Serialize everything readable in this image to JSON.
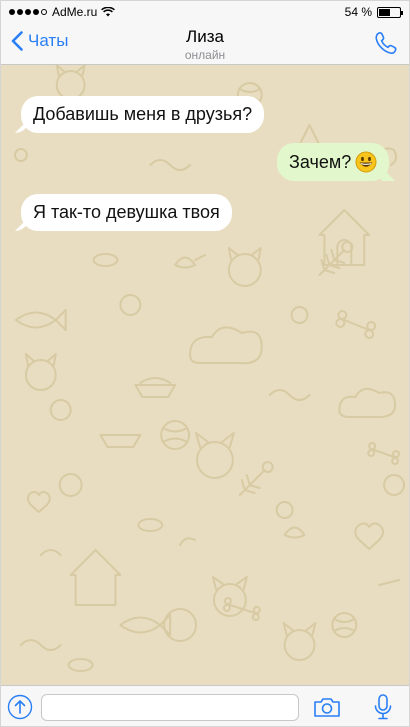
{
  "status_bar": {
    "carrier": "AdMe.ru",
    "battery": "54 %",
    "battery_level": 0.54,
    "signal_dots_filled": 4,
    "signal_dots_total": 5
  },
  "nav": {
    "back_label": "Чаты",
    "contact_name": "Лиза",
    "contact_status": "онлайн",
    "back_icon": "chevron-left-icon",
    "call_icon": "phone-icon"
  },
  "messages": [
    {
      "direction": "incoming",
      "text": "Добавишь меня в друзья?"
    },
    {
      "direction": "outgoing",
      "text": "Зачем?",
      "emoji": "grinning-face"
    },
    {
      "direction": "incoming",
      "text": "Я так-то девушка твоя"
    }
  ],
  "input_bar": {
    "attach_icon": "attach-up-arrow-icon",
    "placeholder": "",
    "value": "",
    "camera_icon": "camera-icon",
    "mic_icon": "microphone-icon"
  },
  "colors": {
    "accent": "#2a7ff6",
    "wallpaper": "#e8ddc0",
    "incoming_bubble": "#ffffff",
    "outgoing_bubble": "#e2f7cb"
  }
}
